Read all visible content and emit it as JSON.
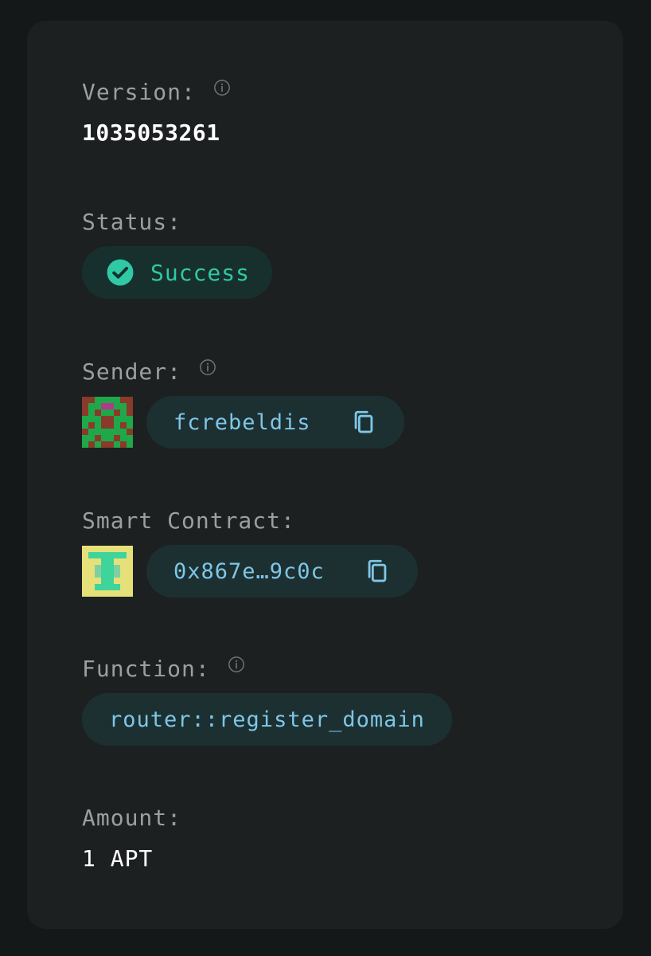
{
  "version": {
    "label": "Version:",
    "value": "1035053261",
    "info_icon": "info-icon"
  },
  "status": {
    "label": "Status:",
    "value": "Success",
    "icon": "check-circle-icon",
    "color": "#2fc9a3"
  },
  "sender": {
    "label": "Sender:",
    "address": "fcrebeldis",
    "info_icon": "info-icon",
    "copy_icon": "copy-icon"
  },
  "smart_contract": {
    "label": "Smart Contract:",
    "address": "0x867e…9c0c",
    "copy_icon": "copy-icon"
  },
  "function": {
    "label": "Function:",
    "value": "router::register_domain",
    "info_icon": "info-icon"
  },
  "amount": {
    "label": "Amount:",
    "value": "1 APT"
  },
  "colors": {
    "background": "#151818",
    "card": "#1d2020",
    "label": "#9aa0a0",
    "link": "#7fc6e6",
    "pill": "#1c3032",
    "success": "#2fc9a3"
  }
}
